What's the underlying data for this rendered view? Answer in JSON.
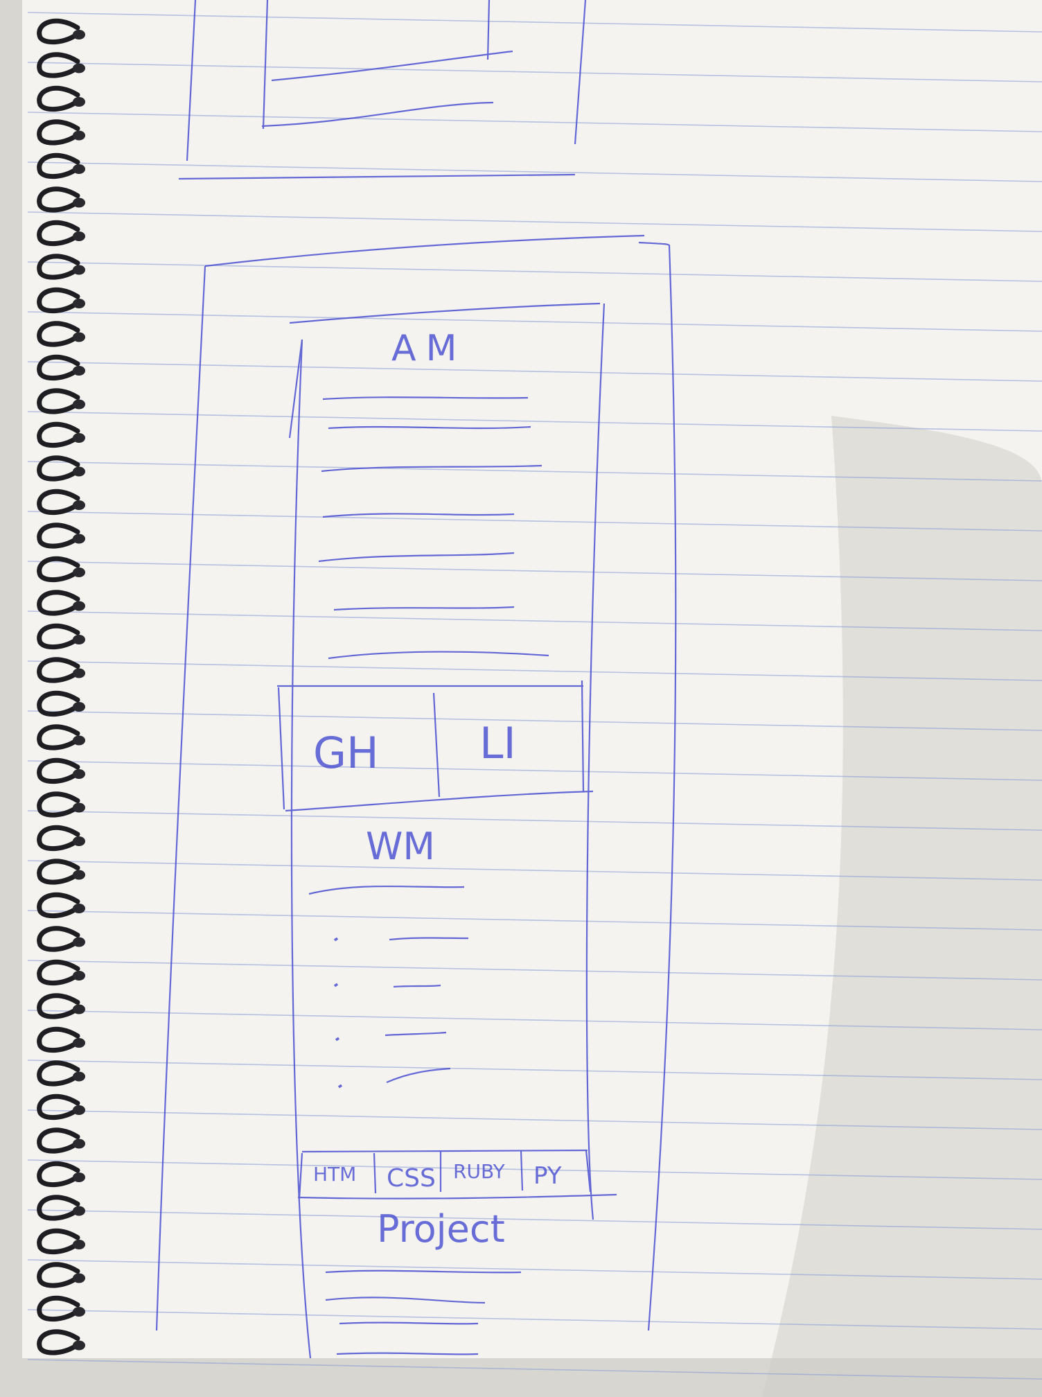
{
  "colors": {
    "paper": "#f4f3ef",
    "rule_line": "#8d9fd6",
    "ink": "#4a4fd1",
    "spiral": "#1e1e22",
    "background": "#d8d6d0"
  },
  "sketch": {
    "header_text": "AM",
    "split_left": "GH",
    "split_right": "LI",
    "middle_heading": "WM",
    "tabs": [
      "HTM",
      "CSS",
      "RUBY",
      "PY"
    ],
    "bottom_heading": "Project"
  }
}
